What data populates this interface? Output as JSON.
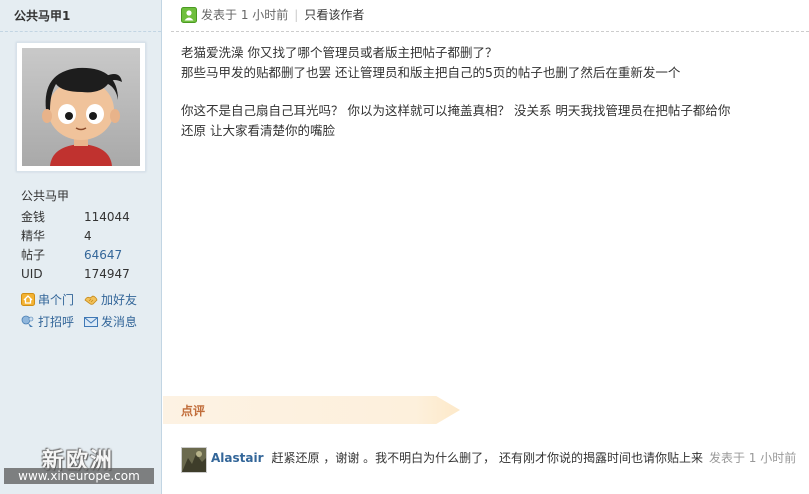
{
  "sidebar": {
    "username": "公共马甲1",
    "display_name": "公共马甲",
    "stats": [
      {
        "label": "金钱",
        "value": "114044"
      },
      {
        "label": "精华",
        "value": "4"
      },
      {
        "label": "帖子",
        "value": "64647"
      },
      {
        "label": "UID",
        "value": "174947"
      }
    ],
    "actions": {
      "visit": "串个门",
      "add_friend": "加好友",
      "greet": "打招呼",
      "message": "发消息"
    }
  },
  "post": {
    "posted_at": "发表于 1 小时前",
    "only_author": "只看该作者",
    "lines": [
      "老猫爱洗澡 你又找了哪个管理员或者版主把帖子都删了？",
      "那些马甲发的贴都删了也罢 还让管理员和版主把自己的5页的帖子也删了然后在重新发一个",
      "你这不是自己扇自己耳光吗？ 你以为这样就可以掩盖真相？ 没关系 明天我找管理员在把帖子都给你",
      "还原 让大家看清楚你的嘴脸"
    ]
  },
  "rating": {
    "label": "点评"
  },
  "comment": {
    "author": "Alastair",
    "text": "赶紧还原 ，谢谢 。我不明白为什么删了， 还有刚才你说的揭露时间也请你贴上来",
    "time": "发表于 1 小时前"
  },
  "watermark": {
    "title": "新欧洲",
    "url": "www.xineurope.com"
  },
  "colors": {
    "sidebar_bg": "#e5edf2",
    "link": "#336699",
    "rating_text": "#c16d3a",
    "rating_bg": "#fdf2e3"
  },
  "icons": {
    "post_status": "online-icon",
    "visit": "home-icon",
    "add_friend": "handshake-icon",
    "greet": "poke-icon",
    "message": "envelope-icon"
  }
}
